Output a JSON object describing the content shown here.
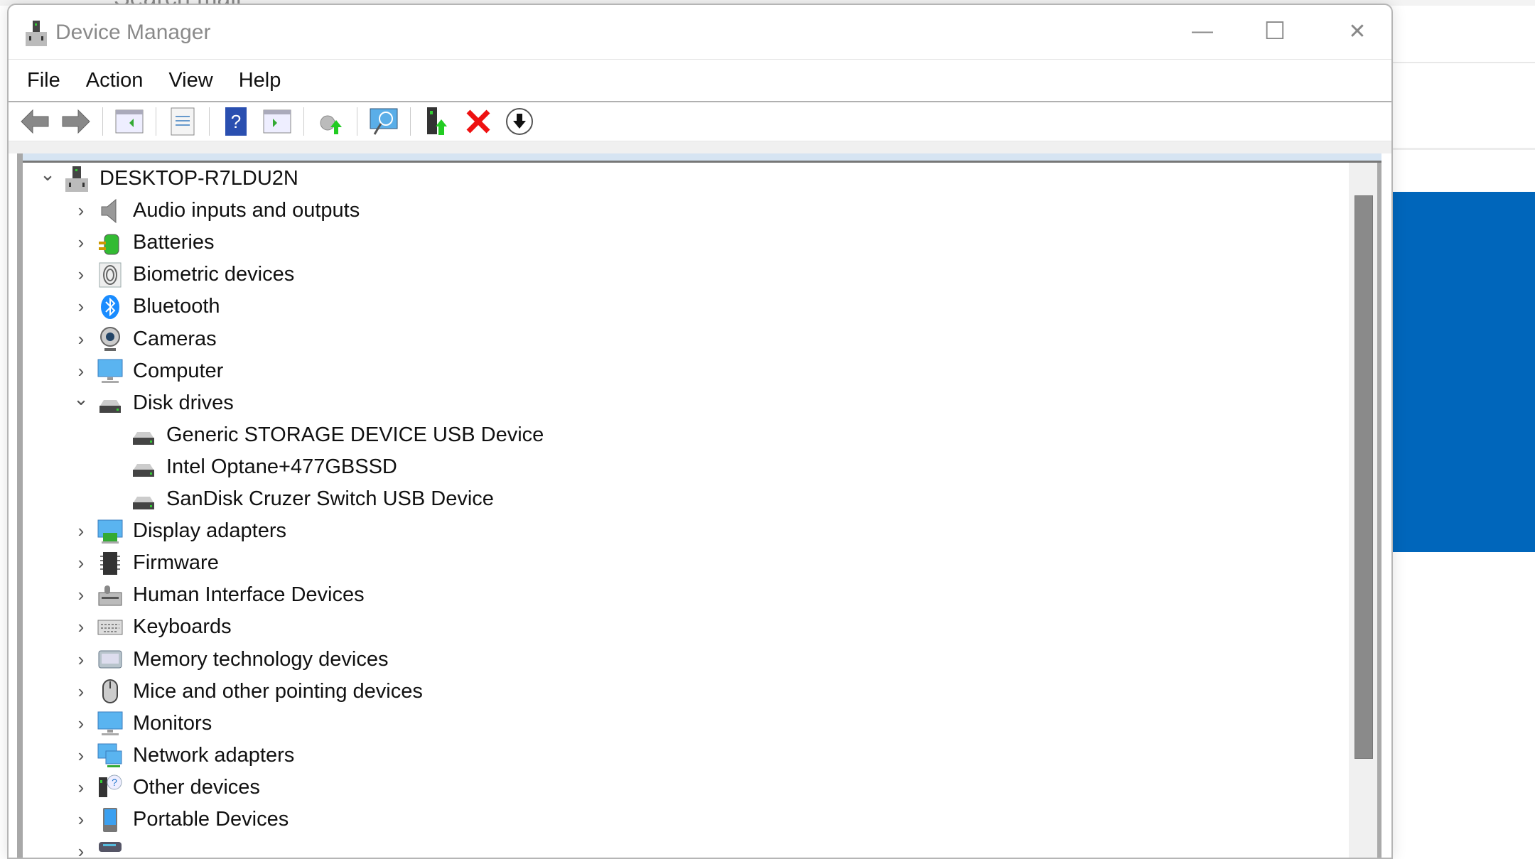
{
  "background": {
    "search_text": "Search mail",
    "accent": "#0066bb"
  },
  "window": {
    "title": "Device Manager",
    "minimize": "—",
    "maximize": "☐",
    "close": "✕"
  },
  "menu": [
    "File",
    "Action",
    "View",
    "Help"
  ],
  "toolbar": [
    "back-icon",
    "forward-icon",
    "show-hide-console-tree-icon",
    "properties-icon",
    "help-icon",
    "show-action-pane-icon",
    "update-driver-icon",
    "scan-hardware-icon",
    "enable-device-icon",
    "uninstall-device-icon",
    "disable-device-icon"
  ],
  "tree": [
    {
      "label": "DESKTOP-R7LDU2N",
      "level": 0,
      "expanded": true,
      "icon": "computer-tower"
    },
    {
      "label": "Audio inputs and outputs",
      "level": 1,
      "expanded": false,
      "icon": "speaker"
    },
    {
      "label": "Batteries",
      "level": 1,
      "expanded": false,
      "icon": "battery"
    },
    {
      "label": "Biometric devices",
      "level": 1,
      "expanded": false,
      "icon": "fingerprint"
    },
    {
      "label": "Bluetooth",
      "level": 1,
      "expanded": false,
      "icon": "bluetooth"
    },
    {
      "label": "Cameras",
      "level": 1,
      "expanded": false,
      "icon": "camera"
    },
    {
      "label": "Computer",
      "level": 1,
      "expanded": false,
      "icon": "monitor"
    },
    {
      "label": "Disk drives",
      "level": 1,
      "expanded": true,
      "icon": "disk"
    },
    {
      "label": "Generic STORAGE DEVICE USB Device",
      "level": 2,
      "icon": "disk"
    },
    {
      "label": "Intel Optane+477GBSSD",
      "level": 2,
      "icon": "disk"
    },
    {
      "label": "SanDisk Cruzer Switch USB Device",
      "level": 2,
      "icon": "disk"
    },
    {
      "label": "Display adapters",
      "level": 1,
      "expanded": false,
      "icon": "display-adapter"
    },
    {
      "label": "Firmware",
      "level": 1,
      "expanded": false,
      "icon": "chip"
    },
    {
      "label": "Human Interface Devices",
      "level": 1,
      "expanded": false,
      "icon": "hid"
    },
    {
      "label": "Keyboards",
      "level": 1,
      "expanded": false,
      "icon": "keyboard"
    },
    {
      "label": "Memory technology devices",
      "level": 1,
      "expanded": false,
      "icon": "memory"
    },
    {
      "label": "Mice and other pointing devices",
      "level": 1,
      "expanded": false,
      "icon": "mouse"
    },
    {
      "label": "Monitors",
      "level": 1,
      "expanded": false,
      "icon": "monitor"
    },
    {
      "label": "Network adapters",
      "level": 1,
      "expanded": false,
      "icon": "network"
    },
    {
      "label": "Other devices",
      "level": 1,
      "expanded": false,
      "icon": "unknown-device"
    },
    {
      "label": "Portable Devices",
      "level": 1,
      "expanded": false,
      "icon": "portable"
    },
    {
      "label": "",
      "level": 1,
      "expanded": false,
      "icon": "printer"
    }
  ],
  "scrollbar": {
    "position_fraction": 0.0,
    "visible_fraction": 0.75
  }
}
